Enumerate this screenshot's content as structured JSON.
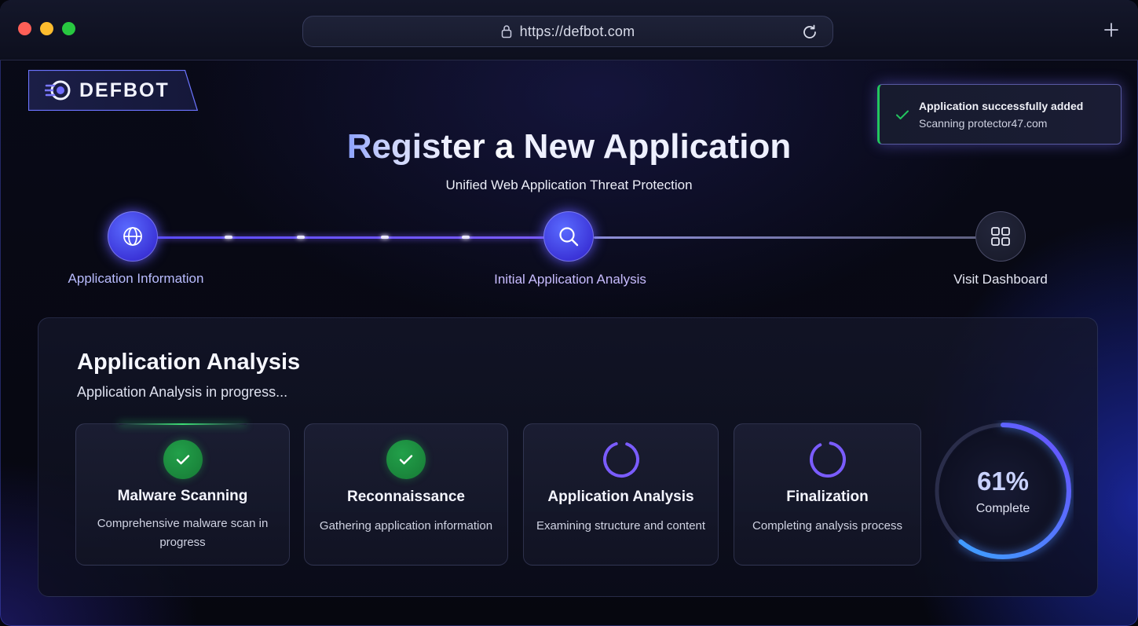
{
  "browser": {
    "url": "https://defbot.com"
  },
  "logo": {
    "text": "DEFBOT"
  },
  "toast": {
    "title": "Application successfully added",
    "message": "Scanning protector47.com",
    "accent_color": "#22c55e"
  },
  "header": {
    "title_part1": "Register a ",
    "title_part2": "New Application",
    "subtitle": "Unified Web Application Threat Protection"
  },
  "stepper": {
    "steps": [
      {
        "label": "Application Information",
        "icon": "globe-icon",
        "state": "completed"
      },
      {
        "label": "Initial Application Analysis",
        "icon": "search-icon",
        "state": "active"
      },
      {
        "label": "Visit Dashboard",
        "icon": "grid-icon",
        "state": "pending"
      }
    ]
  },
  "analysis": {
    "title": "Application Analysis",
    "status": "Application Analysis in progress...",
    "cards": [
      {
        "title": "Malware Scanning",
        "description": "Comprehensive malware scan in progress",
        "state": "done",
        "icon": "check-icon"
      },
      {
        "title": "Reconnaissance",
        "description": "Gathering application information",
        "state": "done",
        "icon": "check-icon"
      },
      {
        "title": "Application Analysis",
        "description": "Examining structure and content",
        "state": "running",
        "icon": "spinner-icon"
      },
      {
        "title": "Finalization",
        "description": "Completing analysis process",
        "state": "running",
        "icon": "spinner-icon"
      }
    ],
    "progress": {
      "percent": 61,
      "percent_text": "61%",
      "label": "Complete"
    }
  },
  "colors": {
    "accent": "#5b4cff",
    "success": "#22c55e",
    "background": "#06070f"
  }
}
